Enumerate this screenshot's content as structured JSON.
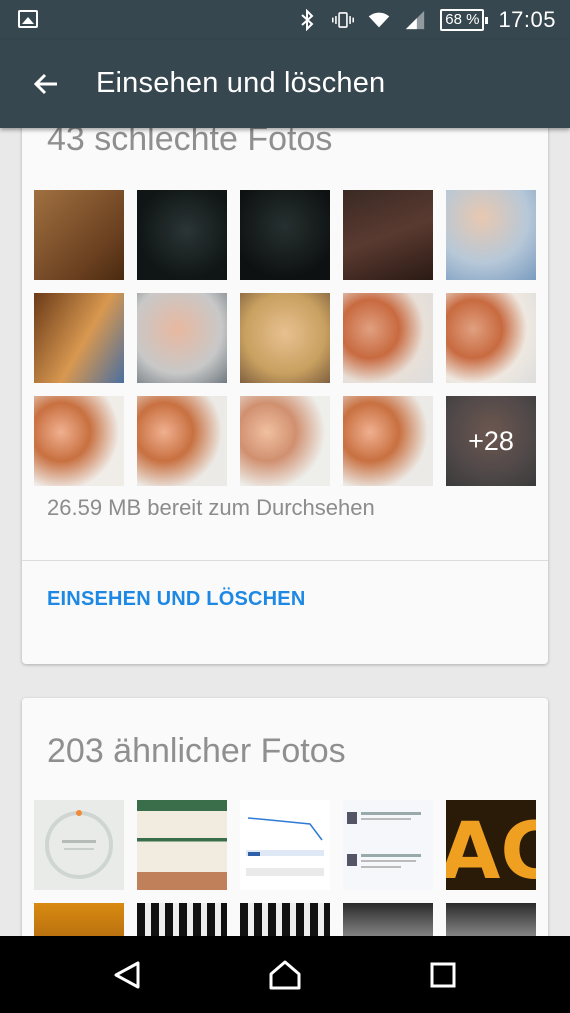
{
  "status": {
    "battery": "68 %",
    "time": "17:05",
    "icons": [
      "image-icon",
      "bluetooth-icon",
      "vibrate-icon",
      "wifi-icon",
      "signal-icon",
      "battery-icon"
    ]
  },
  "appbar": {
    "title": "Einsehen und löschen"
  },
  "bad_card": {
    "title": "43 schlechte Fotos",
    "more_count": "+28",
    "size_text": "26.59 MB bereit zum Durchsehen",
    "action_label": "EINSEHEN UND LÖSCHEN"
  },
  "similar_card": {
    "title": "203 ähnlicher Fotos"
  },
  "colors": {
    "appbar": "#37474f",
    "accent": "#1e88e5",
    "muted_text": "#8f8f8f",
    "card": "#fafafa",
    "background": "#e9e9e9"
  }
}
